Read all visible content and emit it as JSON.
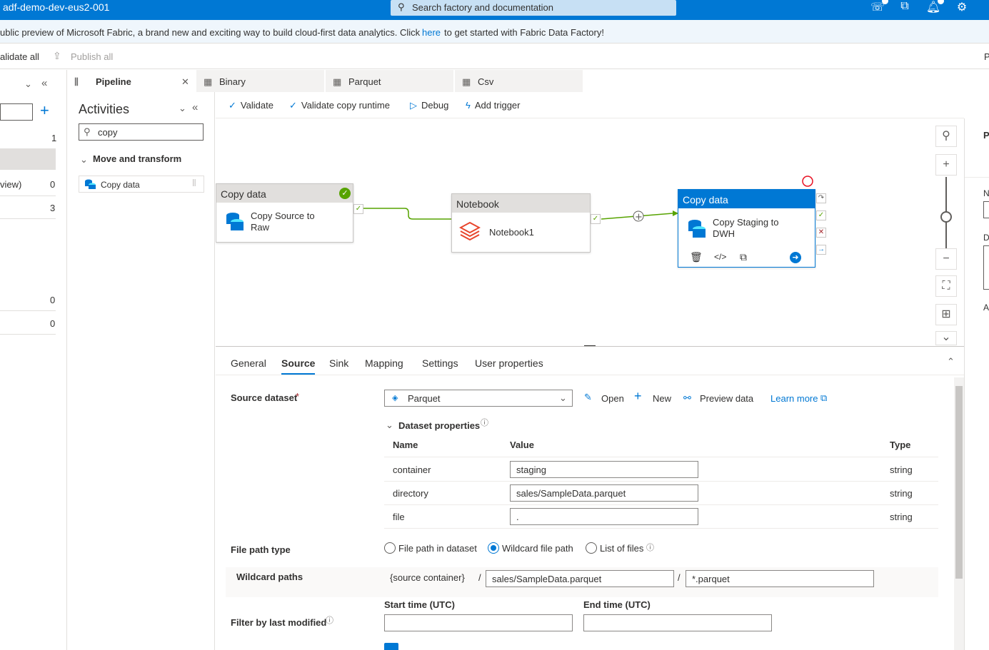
{
  "app": {
    "factory_name": "adf-demo-dev-eus2-001",
    "search_placeholder": "Search factory and documentation"
  },
  "banner": {
    "text_before": "ublic preview of Microsoft Fabric, a brand new and exciting way to build cloud-first data analytics. Click",
    "link": "here",
    "text_after": "to get started with Fabric Data Factory!"
  },
  "cmdbar": {
    "validate_all": "alidate all",
    "publish_all": "Publish all",
    "right_fragment": "P"
  },
  "left_panel": {
    "counts": [
      "1",
      "0",
      "3",
      "0",
      "0"
    ],
    "row_label": "view)"
  },
  "activities": {
    "title": "Activities",
    "search_value": "copy",
    "group": "Move and transform",
    "items": [
      {
        "label": "Copy data"
      }
    ]
  },
  "tabs": [
    {
      "label": "Pipeline"
    },
    {
      "label": "Binary"
    },
    {
      "label": "Parquet"
    },
    {
      "label": "Csv"
    }
  ],
  "toolbar": {
    "validate": "Validate",
    "validate_runtime": "Validate copy runtime",
    "debug": "Debug",
    "add_trigger": "Add trigger"
  },
  "canvas": {
    "activities": [
      {
        "type": "Copy data",
        "name_line1": "Copy Source to",
        "name_line2": "Raw",
        "status": "succeeded"
      },
      {
        "type": "Notebook",
        "name_line1": "Notebook1",
        "name_line2": ""
      },
      {
        "type": "Copy data",
        "name_line1": "Copy Staging to",
        "name_line2": "DWH",
        "selected": true
      }
    ]
  },
  "properties": {
    "tabs": [
      "General",
      "Source",
      "Sink",
      "Mapping",
      "Settings",
      "User properties"
    ],
    "active_tab": "Source",
    "source_dataset_label": "Source dataset",
    "required_marker": "*",
    "source_dataset_value": "Parquet",
    "actions": {
      "open": "Open",
      "new": "New",
      "preview": "Preview data",
      "learn_more": "Learn more"
    },
    "dataset_properties_label": "Dataset properties",
    "columns": {
      "name": "Name",
      "value": "Value",
      "type": "Type"
    },
    "rows": [
      {
        "name": "container",
        "value": "staging",
        "type": "string"
      },
      {
        "name": "directory",
        "value": "sales/SampleData.parquet",
        "type": "string"
      },
      {
        "name": "file",
        "value": ".",
        "type": "string"
      }
    ],
    "file_path_type_label": "File path type",
    "file_path_options": [
      "File path in dataset",
      "Wildcard file path",
      "List of files"
    ],
    "file_path_selected": "Wildcard file path",
    "wildcard_label": "Wildcard paths",
    "wildcard_container": "{source container}",
    "wildcard_sep": "/",
    "wildcard_folder": "sales/SampleData.parquet",
    "wildcard_file": "*.parquet",
    "filter_label": "Filter by last modified",
    "start_time_label": "Start time (UTC)",
    "end_time_label": "End time (UTC)",
    "start_time_value": "",
    "end_time_value": ""
  },
  "right_panel": {
    "letters": [
      "P",
      "N",
      "D",
      "A"
    ]
  },
  "colors": {
    "brand": "#0078d4",
    "success": "#57a300",
    "error": "#a4262c"
  }
}
